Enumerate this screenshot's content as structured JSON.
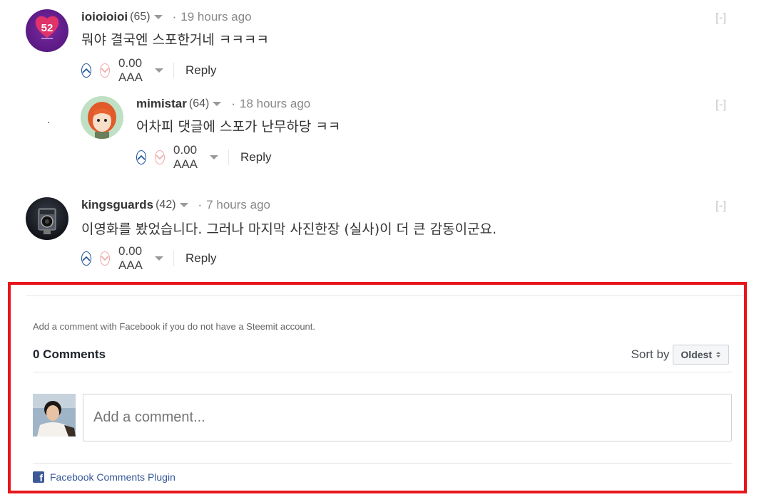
{
  "comments": [
    {
      "author": "ioioioioi",
      "reputation": "(65)",
      "time": "19 hours ago",
      "body": "뭐야 결국엔 스포한거네 ㅋㅋㅋㅋ",
      "payout": "0.00 AAA",
      "reply_label": "Reply",
      "collapse_label": "[-]",
      "avatar_text": "52"
    },
    {
      "author": "mimistar",
      "reputation": "(64)",
      "time": "18 hours ago",
      "body": "어차피 댓글에 스포가 난무하당 ㅋㅋ",
      "payout": "0.00 AAA",
      "reply_label": "Reply",
      "collapse_label": "[-]"
    },
    {
      "author": "kingsguards",
      "reputation": "(42)",
      "time": "7 hours ago",
      "body": "이영화를 봤었습니다. 그러나 마지막 사진한장 (실사)이 더 큰 감동이군요.",
      "payout": "0.00 AAA",
      "reply_label": "Reply",
      "collapse_label": "[-]"
    }
  ],
  "separator_dot": "·",
  "facebook": {
    "note": "Add a comment with Facebook if you do not have a Steemit account.",
    "count_label": "0 Comments",
    "sort_label": "Sort by",
    "sort_value": "Oldest",
    "input_placeholder": "Add a comment...",
    "plugin_label": "Facebook Comments Plugin",
    "logo_letter": "f",
    "border_color": "#e8161b",
    "link_color": "#365899"
  },
  "colors": {
    "upvote": "#1a5099",
    "downvote": "#f0a8a8"
  }
}
